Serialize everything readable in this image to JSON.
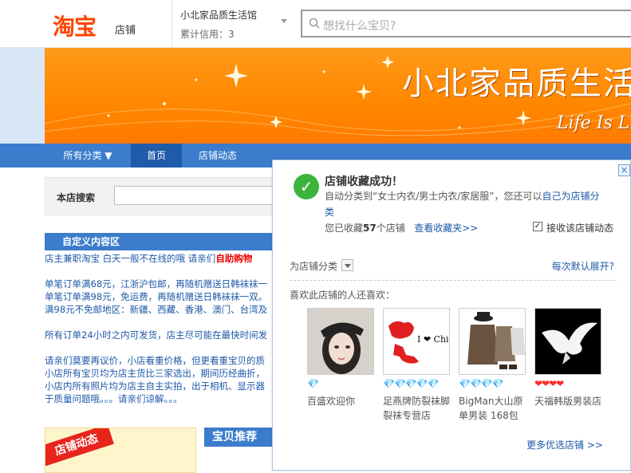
{
  "header": {
    "logo_text": "淘宝",
    "logo_sub": "店铺",
    "shop_name": "小北家品质生活馆",
    "credit": "累计信用：3",
    "search_placeholder": "想找什么宝贝?"
  },
  "banner": {
    "title": "小北家品质生活馆",
    "subtitle": "Life Is Li"
  },
  "nav": {
    "all_categories": "所有分类 ▼",
    "home": "首页",
    "news": "店铺动态"
  },
  "shop_search": {
    "label": "本店搜索"
  },
  "custom_area": {
    "title": "自定义内容区",
    "lines": [
      [
        "店主兼职淘宝  白天一般不在线的哦  请亲们",
        "自助购物"
      ],
      "单笔订单满68元，江浙沪包邮，再随机赠送日韩袜袜一",
      "单笔订单满98元，免运费，再随机赠送日韩袜袜一双。",
      "满98元不免邮地区：新疆、西藏、香港、澳门、台湾及",
      "所有订单24小时之内可发货，店主尽可能在最快时间发",
      "请亲们莫要再议价，小店看重价格，但更看重宝贝的质",
      "小店所有宝贝均为店主货比三家选出，期间历经曲折，",
      "小店内所有照片均为店主自主实拍，出于相机、显示器",
      "于质量问题哦。。。请亲们谅解。。。"
    ]
  },
  "bottom": {
    "shop_news": "店铺动态",
    "recommend": "宝贝推荐"
  },
  "popup": {
    "close": "×",
    "success_title": "店铺收藏成功！",
    "auto_category_prefix": "自动分类到“女士内衣/男士内衣/家居服”，您还可以",
    "auto_category_link": "自己为店铺分",
    "auto_category_link2": "类",
    "collected_prefix": "您已收藏",
    "collected_count": "57",
    "collected_suffix": "个店铺",
    "view_favorites": "查看收藏夹>>",
    "receive_news_label": "接收该店铺动态",
    "receive_news_checked": true,
    "category_label": "为店铺分类",
    "default_expand": "每次默认展开?",
    "also_like": "喜欢此店铺的人还喜欢：",
    "shops": [
      {
        "name": "百盛欢迎你",
        "rating": "diamond-1",
        "rating_glyphs": "💎"
      },
      {
        "name": "足燕牌防裂袜脚裂袜专营店",
        "rating": "diamond-5",
        "rating_glyphs": "💎💎💎💎💎"
      },
      {
        "name": "BigMan大山原单男装 168包",
        "rating": "diamond-4",
        "rating_glyphs": "💎💎💎💎"
      },
      {
        "name": "天福韩版男装店",
        "rating": "heart-4",
        "rating_glyphs": "❤❤❤❤"
      }
    ],
    "thumb_china_text": "I ❤ China",
    "more_shops": "更多优选店铺 >>"
  },
  "colors": {
    "brand_orange": "#ff4400",
    "nav_blue": "#3b7ccc",
    "link_blue": "#1e58a8",
    "success_green": "#3db33d"
  }
}
